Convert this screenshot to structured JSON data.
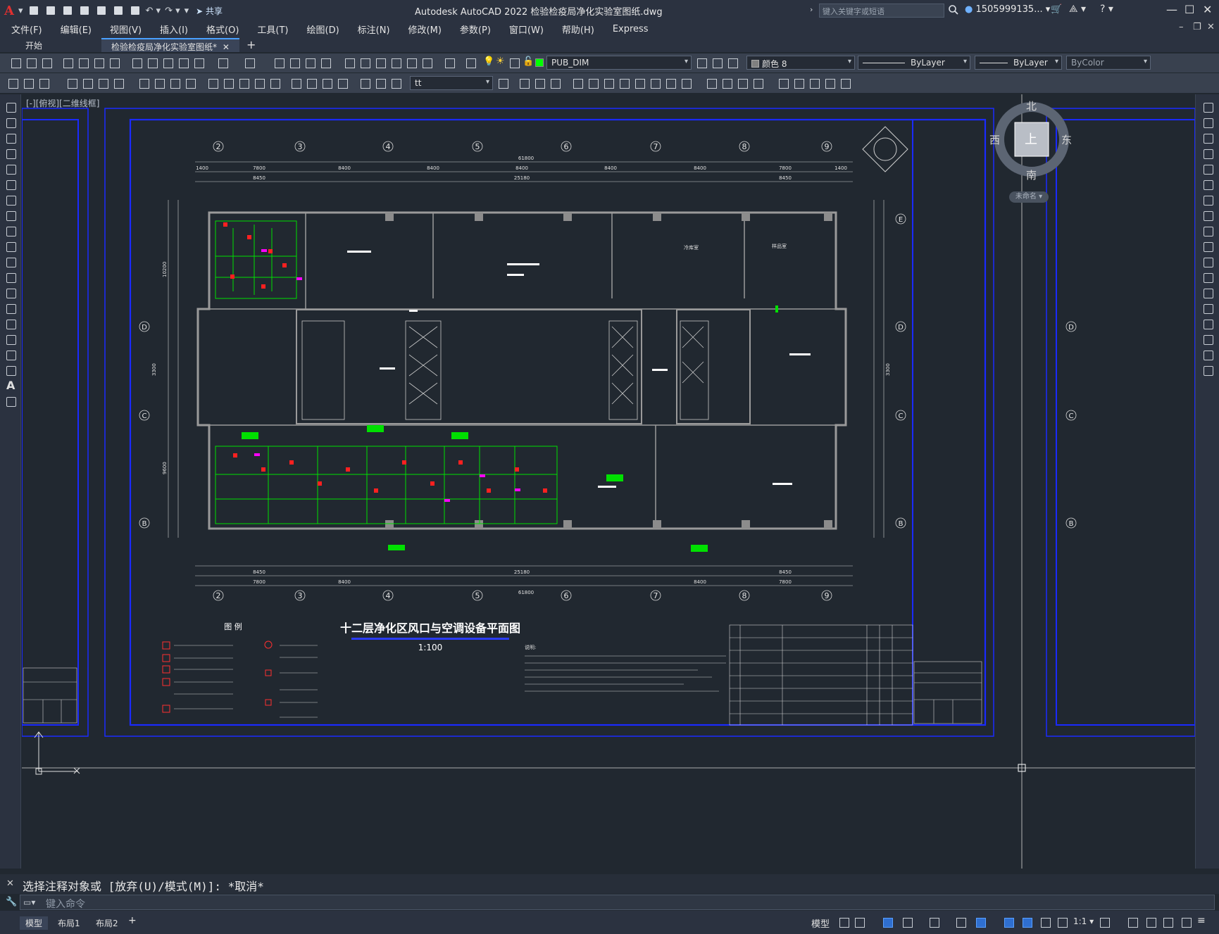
{
  "app": {
    "title": "Autodesk AutoCAD 2022   检验检疫局净化实验室图纸.dwg",
    "share_label": "共享",
    "search_placeholder": "键入关键字或短语",
    "user": "1505999135...",
    "accent": "#4aa0ff",
    "logo_text": "A"
  },
  "menu": [
    "文件(F)",
    "编辑(E)",
    "视图(V)",
    "插入(I)",
    "格式(O)",
    "工具(T)",
    "绘图(D)",
    "标注(N)",
    "修改(M)",
    "参数(P)",
    "窗口(W)",
    "帮助(H)",
    "Express"
  ],
  "tabs": [
    {
      "label": "开始",
      "active": false
    },
    {
      "label": "检验检疫局净化实验室图纸*",
      "active": true
    }
  ],
  "toolbar": {
    "layer_name": "PUB_DIM",
    "color_name": "颜色 8",
    "linetype": "ByLayer",
    "lineweight": "ByLayer",
    "plotstyle": "ByColor",
    "textstyle": "tt"
  },
  "viewport": {
    "label": "[-][俯视][二维线框]"
  },
  "viewcube": {
    "north": "北",
    "south": "南",
    "east": "东",
    "west": "西",
    "top": "上",
    "wcs": "未命名"
  },
  "drawing": {
    "title": "十二层净化区风口与空调设备平面图",
    "scale": "1:100",
    "legend_title": "图  例",
    "notes_title": "说明:",
    "grid_cols": [
      "2",
      "3",
      "4",
      "5",
      "6",
      "7",
      "8",
      "9"
    ],
    "grid_rows": [
      "E",
      "D",
      "C",
      "B"
    ],
    "dims_top": [
      "1400",
      "7800",
      "8400",
      "8400",
      "8400",
      "8400",
      "8400",
      "7800",
      "1400"
    ],
    "total": "61800",
    "dim_mid": "25180",
    "dim_left": "8450",
    "rooms": [
      "冷库室",
      "样品室"
    ],
    "left_dims": [
      "10200",
      "3300",
      "9600"
    ]
  },
  "command": {
    "history": "选择注释对象或 [放弃(U)/模式(M)]: *取消*",
    "placeholder": "键入命令"
  },
  "status": {
    "layouts": [
      "模型",
      "布局1",
      "布局2"
    ],
    "active_layout": "模型",
    "model_label": "模型",
    "annot_scale": "1:1"
  }
}
